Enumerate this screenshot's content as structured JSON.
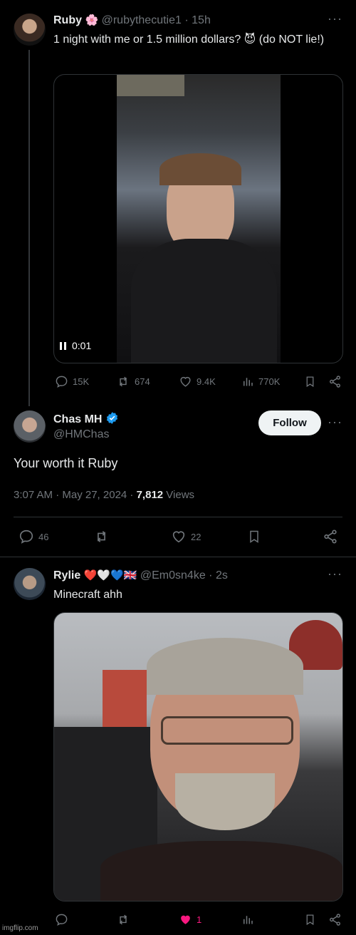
{
  "tweet1": {
    "name": "Ruby",
    "name_emoji": "🌸",
    "handle": "@rubythecutie1",
    "time": "15h",
    "text": "1 night with me or 1.5 million dollars? 😈 (do NOT lie!)",
    "video_time": "0:01",
    "actions": {
      "replies": "15K",
      "reposts": "674",
      "likes": "9.4K",
      "views": "770K"
    }
  },
  "tweet2": {
    "name": "Chas MH",
    "handle": "@HMChas",
    "follow_label": "Follow",
    "text": "Your worth it Ruby",
    "meta_time": "3:07 AM · May 27, 2024 · ",
    "views_count": "7,812",
    "views_label": " Views",
    "actions": {
      "replies": "46",
      "likes": "22"
    }
  },
  "tweet3": {
    "name": "Rylie",
    "name_emoji": "❤️🤍💙🇬🇧",
    "handle": "@Em0sn4ke",
    "time": "2s",
    "text": "Minecraft ahh",
    "actions": {
      "likes": "1"
    }
  },
  "watermark": "imgflip.com",
  "colors": {
    "background": "#000000",
    "text": "#e7e9ea",
    "muted": "#71767b",
    "verified": "#1d9bf0",
    "liked": "#f91880",
    "border": "#2f3336"
  }
}
